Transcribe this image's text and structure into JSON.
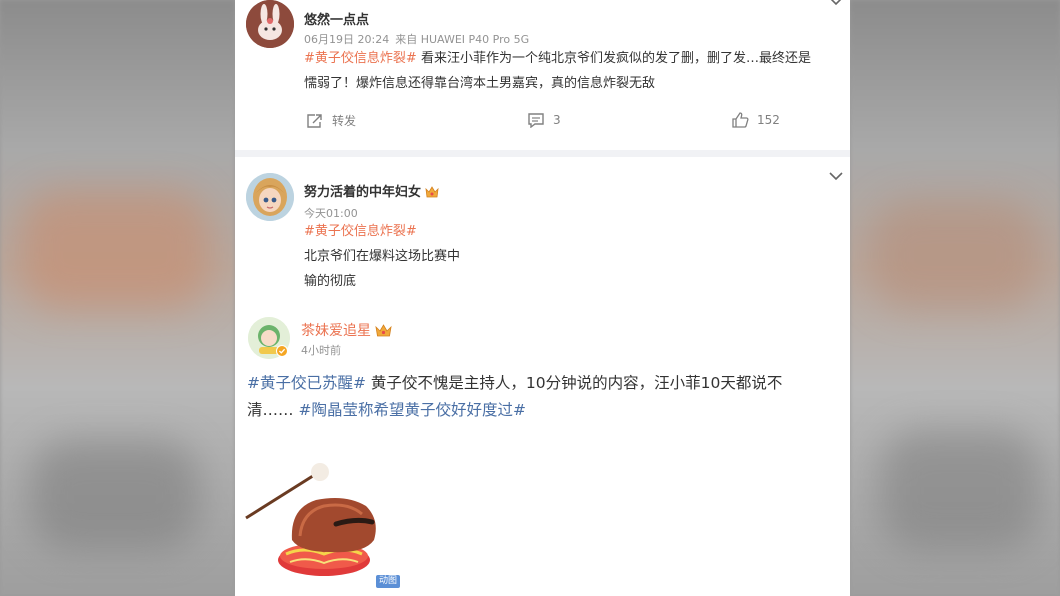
{
  "post1": {
    "username": "悠然一点点",
    "date": "06月19日 20:24",
    "source": "来自 HUAWEI P40 Pro 5G",
    "hashtag": "#黄子佼信息炸裂#",
    "text_line1": "看来汪小菲作为一个纯北京爷们发疯似的发了删，删了发…最终还是",
    "text_line2": "懦弱了！爆炸信息还得靠台湾本土男嘉宾，真的信息炸裂无敌",
    "repost_label": "转发",
    "comment_count": "3",
    "like_count": "152"
  },
  "post2": {
    "username": "努力活着的中年妇女",
    "date": "今天01:00",
    "hashtag": "#黄子佼信息炸裂#",
    "line1": "北京爷们在爆料这场比赛中",
    "line2": "输的彻底"
  },
  "post3": {
    "username": "茶妹爱追星",
    "date": "4小时前",
    "hashtag1": "#黄子佼已苏醒#",
    "text_part1": "黄子佼不愧是主持人，10分钟说的内容，汪小菲10天都说不",
    "text_part2": "清……",
    "hashtag2": "#陶晶莹称希望黄子佼好好度过#",
    "gif_label": "动图"
  },
  "colors": {
    "hashtag_orange": "#eb7350",
    "hashtag_blue": "#4a6fa5",
    "name_orange": "#eb7350"
  },
  "icons": [
    "chevron-down-icon",
    "repost-icon",
    "comment-icon",
    "like-icon",
    "crown-icon",
    "wooden-fish-image"
  ]
}
